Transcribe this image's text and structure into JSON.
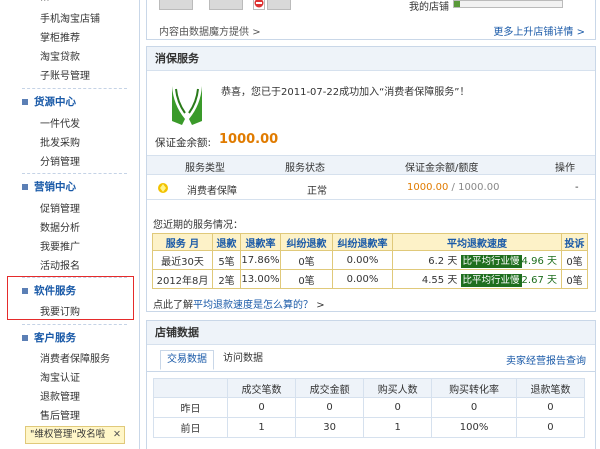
{
  "sidebar": {
    "top_items": [
      "手机淘宝店铺",
      "掌柜推荐",
      "淘宝贷款",
      "子账号管理"
    ],
    "groups": [
      {
        "title": "货源中心",
        "items": [
          "一件代发",
          "批发采购",
          "分销管理"
        ]
      },
      {
        "title": "营销中心",
        "items": [
          "促销管理",
          "数据分析",
          "我要推广",
          "活动报名"
        ]
      },
      {
        "title": "软件服务",
        "items": [
          "我要订购"
        ]
      },
      {
        "title": "客户服务",
        "items": [
          "消费者保障服务",
          "淘宝认证",
          "退款管理",
          "售后管理"
        ]
      }
    ],
    "tooltip": "\"维权管理\"改名啦",
    "tooltip_close": "✕"
  },
  "top": {
    "provider_text": "内容由数据魔方提供",
    "provider_arrow": ">",
    "my_store_label": "我的店铺",
    "more_link": "更多上升店铺详情",
    "more_arrow": ">"
  },
  "consumer": {
    "title": "消保服务",
    "message": "恭喜，您已于2011-07-22成功加入“消费者保障服务”！",
    "deposit_label": "保证金余额:",
    "deposit_value": "1000.00",
    "table_headers": [
      "服务类型",
      "服务状态",
      "保证金余额/额度",
      "操作"
    ],
    "row": {
      "type": "消费者保障",
      "status": "正常",
      "balance": "1000.00",
      "quota": " / 1000.00",
      "action": "-"
    },
    "recent_label": "您近期的服务情况：",
    "rate_headers": [
      "服务 月",
      "退款",
      "退款率",
      "纠纷退款",
      "纠纷退款率",
      "平均退款速度",
      "投诉"
    ],
    "rate_rows": [
      {
        "period": "最近30天",
        "refund": "5笔",
        "rate": "17.86%",
        "dispute": "0笔",
        "dispute_rate": "0.00%",
        "speed": "6.2 天",
        "compare": "比平均行业慢",
        "avg": "4.96 天",
        "complaint": "0笔"
      },
      {
        "period": "2012年8月",
        "refund": "2笔",
        "rate": "13.00%",
        "dispute": "0笔",
        "dispute_rate": "0.00%",
        "speed": "4.55 天",
        "compare": "比平均行业慢",
        "avg": "2.67 天",
        "complaint": "0笔"
      }
    ],
    "help_prefix": "点此了解",
    "help_link": "平均退款速度是怎么算的？",
    "help_arrow": ">"
  },
  "store": {
    "title": "店铺数据",
    "tabs": [
      "交易数据",
      "访问数据"
    ],
    "report_link": "卖家经营报告查询",
    "headers": [
      "",
      "成交笔数",
      "成交金额",
      "购买人数",
      "购买转化率",
      "退款笔数"
    ],
    "rows": [
      [
        "昨日",
        "0",
        "0",
        "0",
        "0",
        "0"
      ],
      [
        "前日",
        "1",
        "30",
        "1",
        "100%",
        "0"
      ]
    ]
  },
  "colors": {
    "accent": "#1a5aa8",
    "amount": "#e07b00",
    "compare_bg": "#1e6e1e",
    "highlight": "#e52b2b"
  }
}
